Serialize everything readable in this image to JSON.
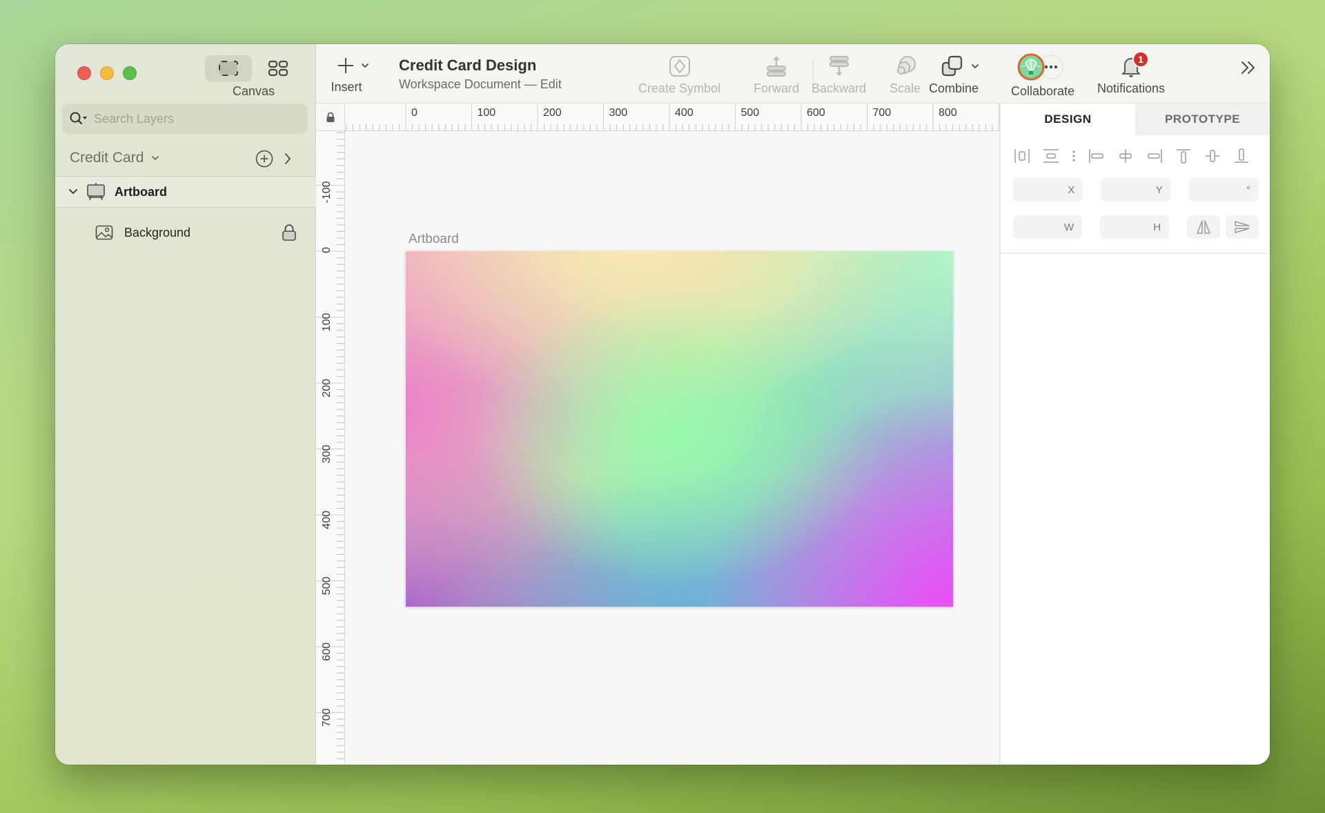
{
  "window": {
    "traffic_lights": [
      "close",
      "minimize",
      "maximize"
    ]
  },
  "sidebar": {
    "view_toggle": {
      "options": [
        {
          "name": "canvas",
          "icon": "canvas-view-icon",
          "active": true
        },
        {
          "name": "grid",
          "icon": "grid-view-icon",
          "active": false
        }
      ],
      "label": "Canvas"
    },
    "search": {
      "placeholder": "Search Layers",
      "value": ""
    },
    "page": {
      "name": "Credit Card"
    },
    "layers": [
      {
        "name": "Artboard",
        "type": "artboard",
        "expanded": true,
        "icon": "artboard-icon"
      },
      {
        "name": "Background",
        "type": "image",
        "locked": true,
        "icon": "image-icon"
      }
    ]
  },
  "toolbar": {
    "insert_label": "Insert",
    "document": {
      "title": "Credit Card Design",
      "subtitle": "Workspace Document — Edit"
    },
    "create_symbol_label": "Create Symbol",
    "forward_label": "Forward",
    "backward_label": "Backward",
    "scale_label": "Scale",
    "combine_label": "Combine",
    "collaborate_label": "Collaborate",
    "notifications_label": "Notifications",
    "notifications_count": "1"
  },
  "canvas": {
    "ruler_h_labels": [
      "0",
      "100",
      "200",
      "300",
      "400",
      "500",
      "600",
      "700",
      "800"
    ],
    "ruler_v_labels": [
      "-100",
      "0",
      "100",
      "200",
      "300",
      "400",
      "500",
      "600",
      "700"
    ],
    "artboard_label": "Artboard",
    "gradient_colors": {
      "top_left": "#ea8fc6",
      "top_center": "#f8e6b4",
      "top_right": "#b8f2c4",
      "center": "#96f8aa",
      "bottom_left": "#a66ad0",
      "bottom_center": "#72b4d6",
      "bottom_right": "#e553f6"
    }
  },
  "inspector": {
    "tabs": [
      {
        "label": "DESIGN",
        "active": true
      },
      {
        "label": "PROTOTYPE",
        "active": false
      }
    ],
    "fields": {
      "x": {
        "label": "X",
        "value": ""
      },
      "y": {
        "label": "Y",
        "value": ""
      },
      "rotation": {
        "label": "°",
        "value": ""
      },
      "w": {
        "label": "W",
        "value": ""
      },
      "h": {
        "label": "H",
        "value": ""
      }
    }
  },
  "colors": {
    "notification_badge": "#d32f2a",
    "avatar_ring": "#e0642a",
    "avatar_fill": "#7fd7a0"
  }
}
